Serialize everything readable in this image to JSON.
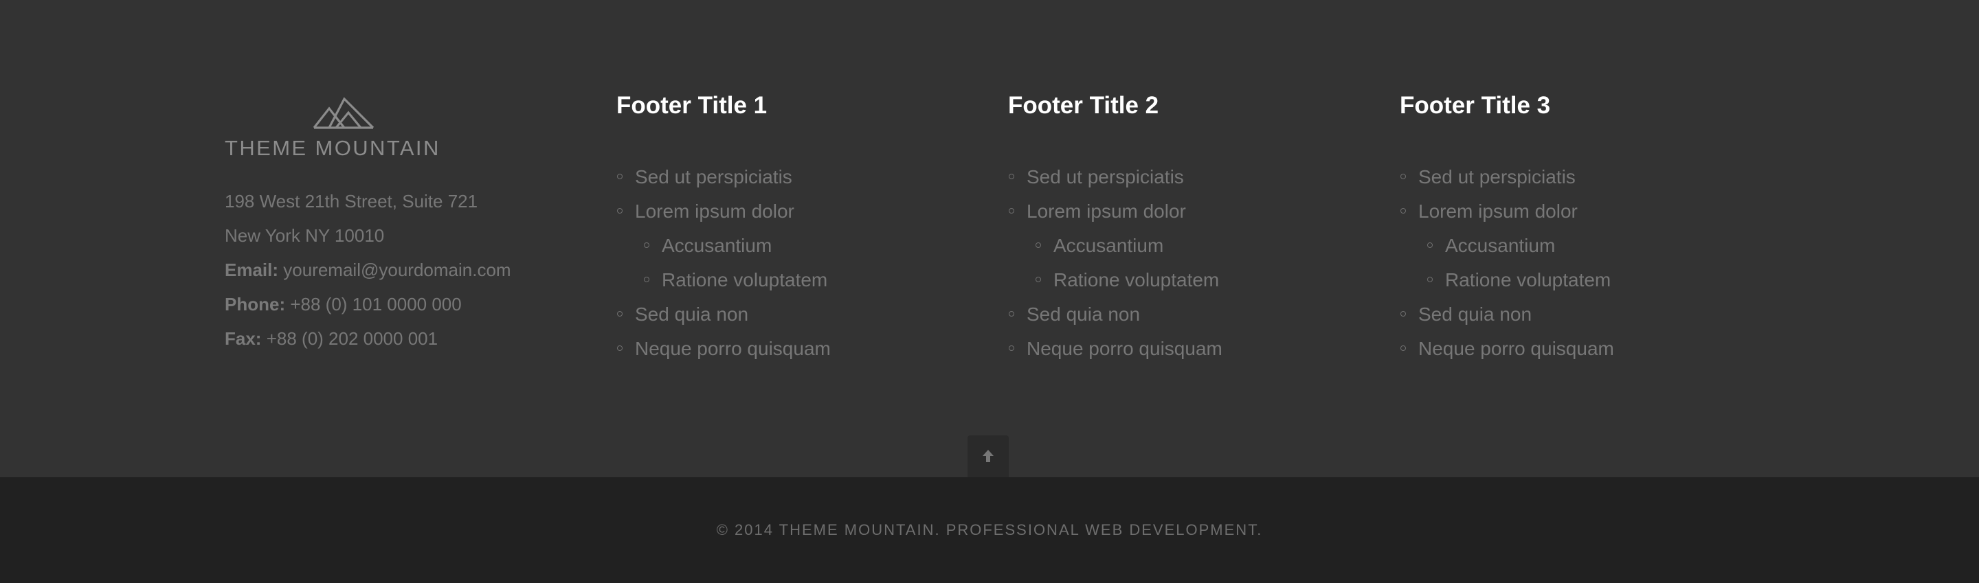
{
  "brand": {
    "name": "THEME MOUNTAIN",
    "address_line1": "198 West 21th Street, Suite 721",
    "address_line2": "New York NY 10010",
    "email_label": "Email:",
    "email_value": "youremail@yourdomain.com",
    "phone_label": "Phone:",
    "phone_value": "+88 (0) 101 0000 000",
    "fax_label": "Fax:",
    "fax_value": "+88 (0) 202 0000 001"
  },
  "columns": [
    {
      "title": "Footer Title 1",
      "items": [
        "Sed ut perspiciatis",
        "Lorem ipsum dolor",
        "Accusantium",
        "Ratione voluptatem",
        "Sed quia non",
        "Neque porro quisquam"
      ]
    },
    {
      "title": "Footer Title 2",
      "items": [
        "Sed ut perspiciatis",
        "Lorem ipsum dolor",
        "Accusantium",
        "Ratione voluptatem",
        "Sed quia non",
        "Neque porro quisquam"
      ]
    },
    {
      "title": "Footer Title 3",
      "items": [
        "Sed ut perspiciatis",
        "Lorem ipsum dolor",
        "Accusantium",
        "Ratione voluptatem",
        "Sed quia non",
        "Neque porro quisquam"
      ]
    }
  ],
  "back_to_top": {
    "icon": "arrow-up-icon"
  },
  "copyright": "© 2014 THEME MOUNTAIN. PROFESSIONAL WEB DEVELOPMENT.",
  "colors": {
    "footer_bg": "#333333",
    "bottom_bar_bg": "#212121",
    "title": "#ffffff",
    "text": "#777777"
  }
}
